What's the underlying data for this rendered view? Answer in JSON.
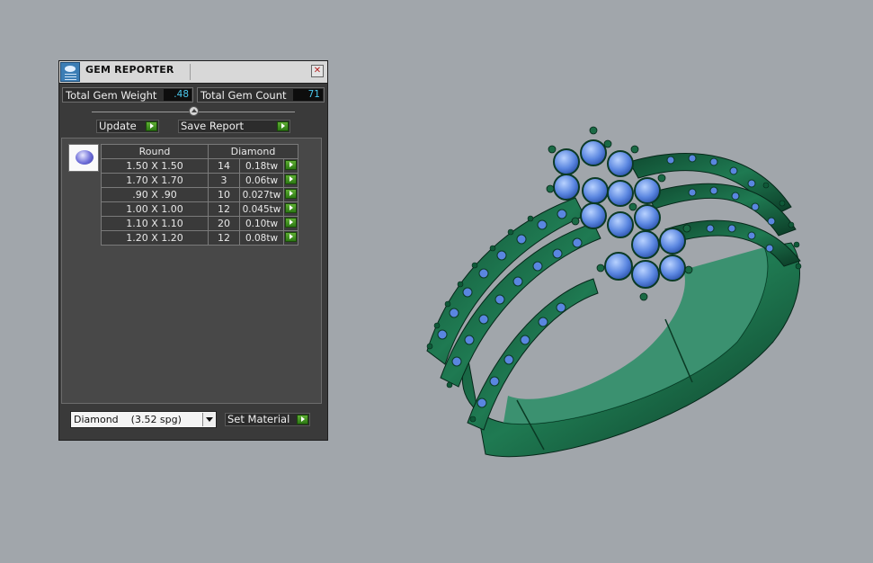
{
  "window": {
    "title": "GEM REPORTER",
    "close_icon": "close-icon"
  },
  "stats": {
    "weight_label": "Total Gem Weight",
    "weight_value": ".48",
    "count_label": "Total Gem Count",
    "count_value": "71"
  },
  "buttons": {
    "update": "Update",
    "save_report": "Save Report",
    "set_material": "Set Material"
  },
  "table": {
    "headers": {
      "shape": "Round",
      "material": "Diamond"
    },
    "rows": [
      {
        "size": "1.50 X 1.50",
        "count": "14",
        "weight": "0.18tw"
      },
      {
        "size": "1.70 X 1.70",
        "count": "3",
        "weight": "0.06tw"
      },
      {
        "size": ".90 X .90",
        "count": "10",
        "weight": "0.027tw"
      },
      {
        "size": "1.00 X 1.00",
        "count": "12",
        "weight": "0.045tw"
      },
      {
        "size": "1.10 X 1.10",
        "count": "20",
        "weight": "0.10tw"
      },
      {
        "size": "1.20 X 1.20",
        "count": "12",
        "weight": "0.08tw"
      }
    ]
  },
  "material_select": {
    "value": "Diamond    (3.52 spg)"
  },
  "colors": {
    "background": "#a1a6ab",
    "ring_metal": "#1f7a52",
    "gem_blue": "#5a86e0",
    "accent_green": "#3d9a22",
    "value_cyan": "#4bc8ee"
  }
}
